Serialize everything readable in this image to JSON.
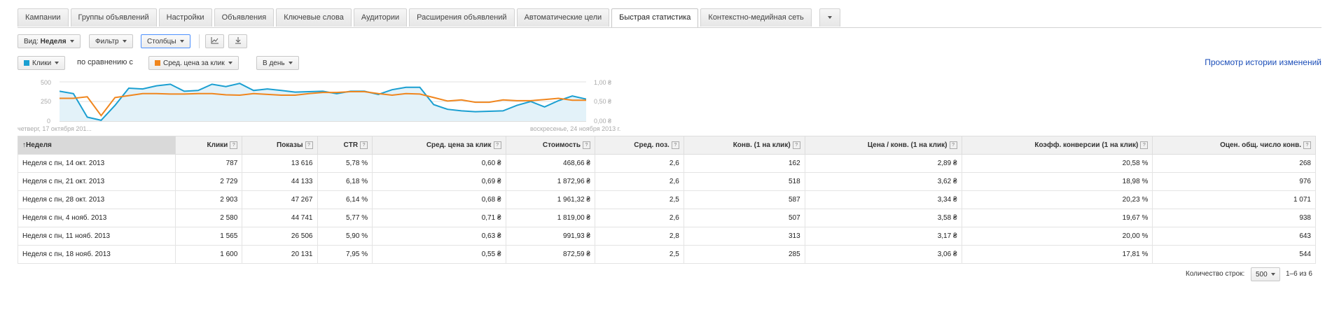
{
  "tabs": [
    "Кампании",
    "Группы объявлений",
    "Настройки",
    "Объявления",
    "Ключевые слова",
    "Аудитории",
    "Расширения объявлений",
    "Автоматические цели",
    "Быстрая статистика",
    "Контекстно-медийная сеть"
  ],
  "toolbar": {
    "view_prefix": "Вид:",
    "view_value": "Неделя",
    "filter": "Фильтр",
    "columns": "Столбцы"
  },
  "compare": {
    "metric1": "Клики",
    "metric1_color": "#1a9fd1",
    "compare_text": "по сравнению с",
    "metric2": "Сред. цена за клик",
    "metric2_color": "#f0861e",
    "period": "В день",
    "history_link": "Просмотр истории изменений"
  },
  "chart_data": {
    "type": "line",
    "x_start_label": "четверг, 17 октября 201...",
    "x_end_label": "воскресенье, 24 ноября 2013 г.",
    "y_left_ticks": [
      "500",
      "250",
      "0"
    ],
    "y_left_range": [
      0,
      500
    ],
    "y_right_ticks": [
      "1,00 ₴",
      "0,50 ₴",
      "0,00 ₴"
    ],
    "y_right_range": [
      0,
      1
    ],
    "series": [
      {
        "name": "Клики",
        "color": "#1a9fd1",
        "axis": "left",
        "values": [
          380,
          350,
          50,
          10,
          200,
          420,
          410,
          450,
          470,
          380,
          390,
          470,
          440,
          480,
          390,
          410,
          390,
          370,
          375,
          380,
          350,
          380,
          380,
          340,
          400,
          430,
          430,
          210,
          150,
          130,
          120,
          125,
          130,
          200,
          250,
          180,
          260,
          320,
          280
        ]
      },
      {
        "name": "Сред. цена за клик",
        "color": "#f0861e",
        "axis": "right",
        "values": [
          0.58,
          0.58,
          0.62,
          0.14,
          0.6,
          0.65,
          0.7,
          0.7,
          0.69,
          0.69,
          0.7,
          0.7,
          0.67,
          0.66,
          0.7,
          0.68,
          0.66,
          0.66,
          0.7,
          0.73,
          0.73,
          0.75,
          0.75,
          0.7,
          0.66,
          0.7,
          0.69,
          0.6,
          0.51,
          0.54,
          0.48,
          0.48,
          0.54,
          0.52,
          0.52,
          0.55,
          0.58,
          0.53,
          0.53
        ]
      }
    ]
  },
  "table": {
    "headers": [
      "Неделя",
      "Клики",
      "Показы",
      "CTR",
      "Сред. цена за клик",
      "Стоимость",
      "Сред. поз.",
      "Конв. (1 на клик)",
      "Цена / конв. (1 на клик)",
      "Коэфф. конверсии (1 на клик)",
      "Оцен. общ. число конв."
    ],
    "rows": [
      [
        "Неделя с пн, 14 окт. 2013",
        "787",
        "13 616",
        "5,78 %",
        "0,60 ₴",
        "468,66 ₴",
        "2,6",
        "162",
        "2,89 ₴",
        "20,58 %",
        "268"
      ],
      [
        "Неделя с пн, 21 окт. 2013",
        "2 729",
        "44 133",
        "6,18 %",
        "0,69 ₴",
        "1 872,96 ₴",
        "2,6",
        "518",
        "3,62 ₴",
        "18,98 %",
        "976"
      ],
      [
        "Неделя с пн, 28 окт. 2013",
        "2 903",
        "47 267",
        "6,14 %",
        "0,68 ₴",
        "1 961,32 ₴",
        "2,5",
        "587",
        "3,34 ₴",
        "20,23 %",
        "1 071"
      ],
      [
        "Неделя с пн, 4 нояб. 2013",
        "2 580",
        "44 741",
        "5,77 %",
        "0,71 ₴",
        "1 819,00 ₴",
        "2,6",
        "507",
        "3,58 ₴",
        "19,67 %",
        "938"
      ],
      [
        "Неделя с пн, 11 нояб. 2013",
        "1 565",
        "26 506",
        "5,90 %",
        "0,63 ₴",
        "991,93 ₴",
        "2,8",
        "313",
        "3,17 ₴",
        "20,00 %",
        "643"
      ],
      [
        "Неделя с пн, 18 нояб. 2013",
        "1 600",
        "20 131",
        "7,95 %",
        "0,55 ₴",
        "872,59 ₴",
        "2,5",
        "285",
        "3,06 ₴",
        "17,81 %",
        "544"
      ]
    ]
  },
  "footer": {
    "rows_label": "Количество строк:",
    "rows_value": "500",
    "range": "1–6 из 6"
  }
}
